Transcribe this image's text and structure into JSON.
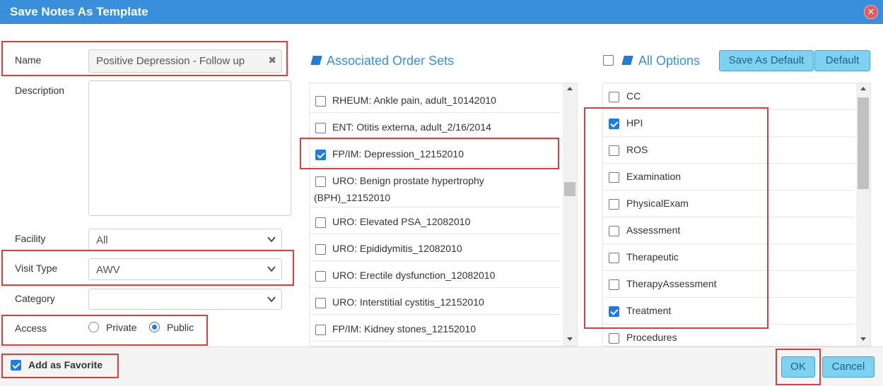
{
  "window": {
    "title": "Save Notes As Template",
    "close_glyph": "✕"
  },
  "form": {
    "name_label": "Name",
    "name_value": "Positive Depression - Follow up",
    "clear_glyph": "✖",
    "description_label": "Description",
    "facility_label": "Facility",
    "facility_value": "All",
    "visit_type_label": "Visit Type",
    "visit_type_value": "AWV",
    "category_label": "Category",
    "category_value": "",
    "access_label": "Access",
    "access_options": [
      {
        "label": "Private",
        "selected": false
      },
      {
        "label": "Public",
        "selected": true
      }
    ]
  },
  "order_sets": {
    "header": "Associated Order Sets",
    "items": [
      {
        "label": "RHEUM: Ankle pain, adult_10142010",
        "checked": false
      },
      {
        "label": "ENT: Otitis externa, adult_2/16/2014",
        "checked": false
      },
      {
        "label": "FP/IM: Depression_12152010",
        "checked": true
      },
      {
        "label_line1": "URO: Benign prostate hypertrophy",
        "label_line2": "(BPH)_12152010",
        "checked": false
      },
      {
        "label": "URO: Elevated PSA_12082010",
        "checked": false
      },
      {
        "label": "URO: Epididymitis_12082010",
        "checked": false
      },
      {
        "label": "URO: Erectile dysfunction_12082010",
        "checked": false
      },
      {
        "label": "URO: Interstitial cystitis_12152010",
        "checked": false
      },
      {
        "label": "FP/IM: Kidney stones_12152010",
        "checked": false
      }
    ]
  },
  "options": {
    "header": "All Options",
    "select_all_checked": false,
    "save_default_label": "Save As Default",
    "default_label": "Default",
    "items": [
      {
        "label": "CC",
        "checked": false
      },
      {
        "label": "HPI",
        "checked": true
      },
      {
        "label": "ROS",
        "checked": false
      },
      {
        "label": "Examination",
        "checked": false
      },
      {
        "label": "PhysicalExam",
        "checked": false
      },
      {
        "label": "Assessment",
        "checked": false
      },
      {
        "label": "Therapeutic",
        "checked": false
      },
      {
        "label": "TherapyAssessment",
        "checked": false
      },
      {
        "label": "Treatment",
        "checked": true
      },
      {
        "label": "Procedures",
        "checked": false
      }
    ]
  },
  "footer": {
    "favorite_label": "Add as Favorite",
    "favorite_checked": true,
    "ok_label": "OK",
    "cancel_label": "Cancel"
  },
  "colors": {
    "titlebar": "#3a8fdb",
    "accent": "#1e7be0",
    "highlight": "#e03c3c",
    "button": "#7fd1f1"
  }
}
